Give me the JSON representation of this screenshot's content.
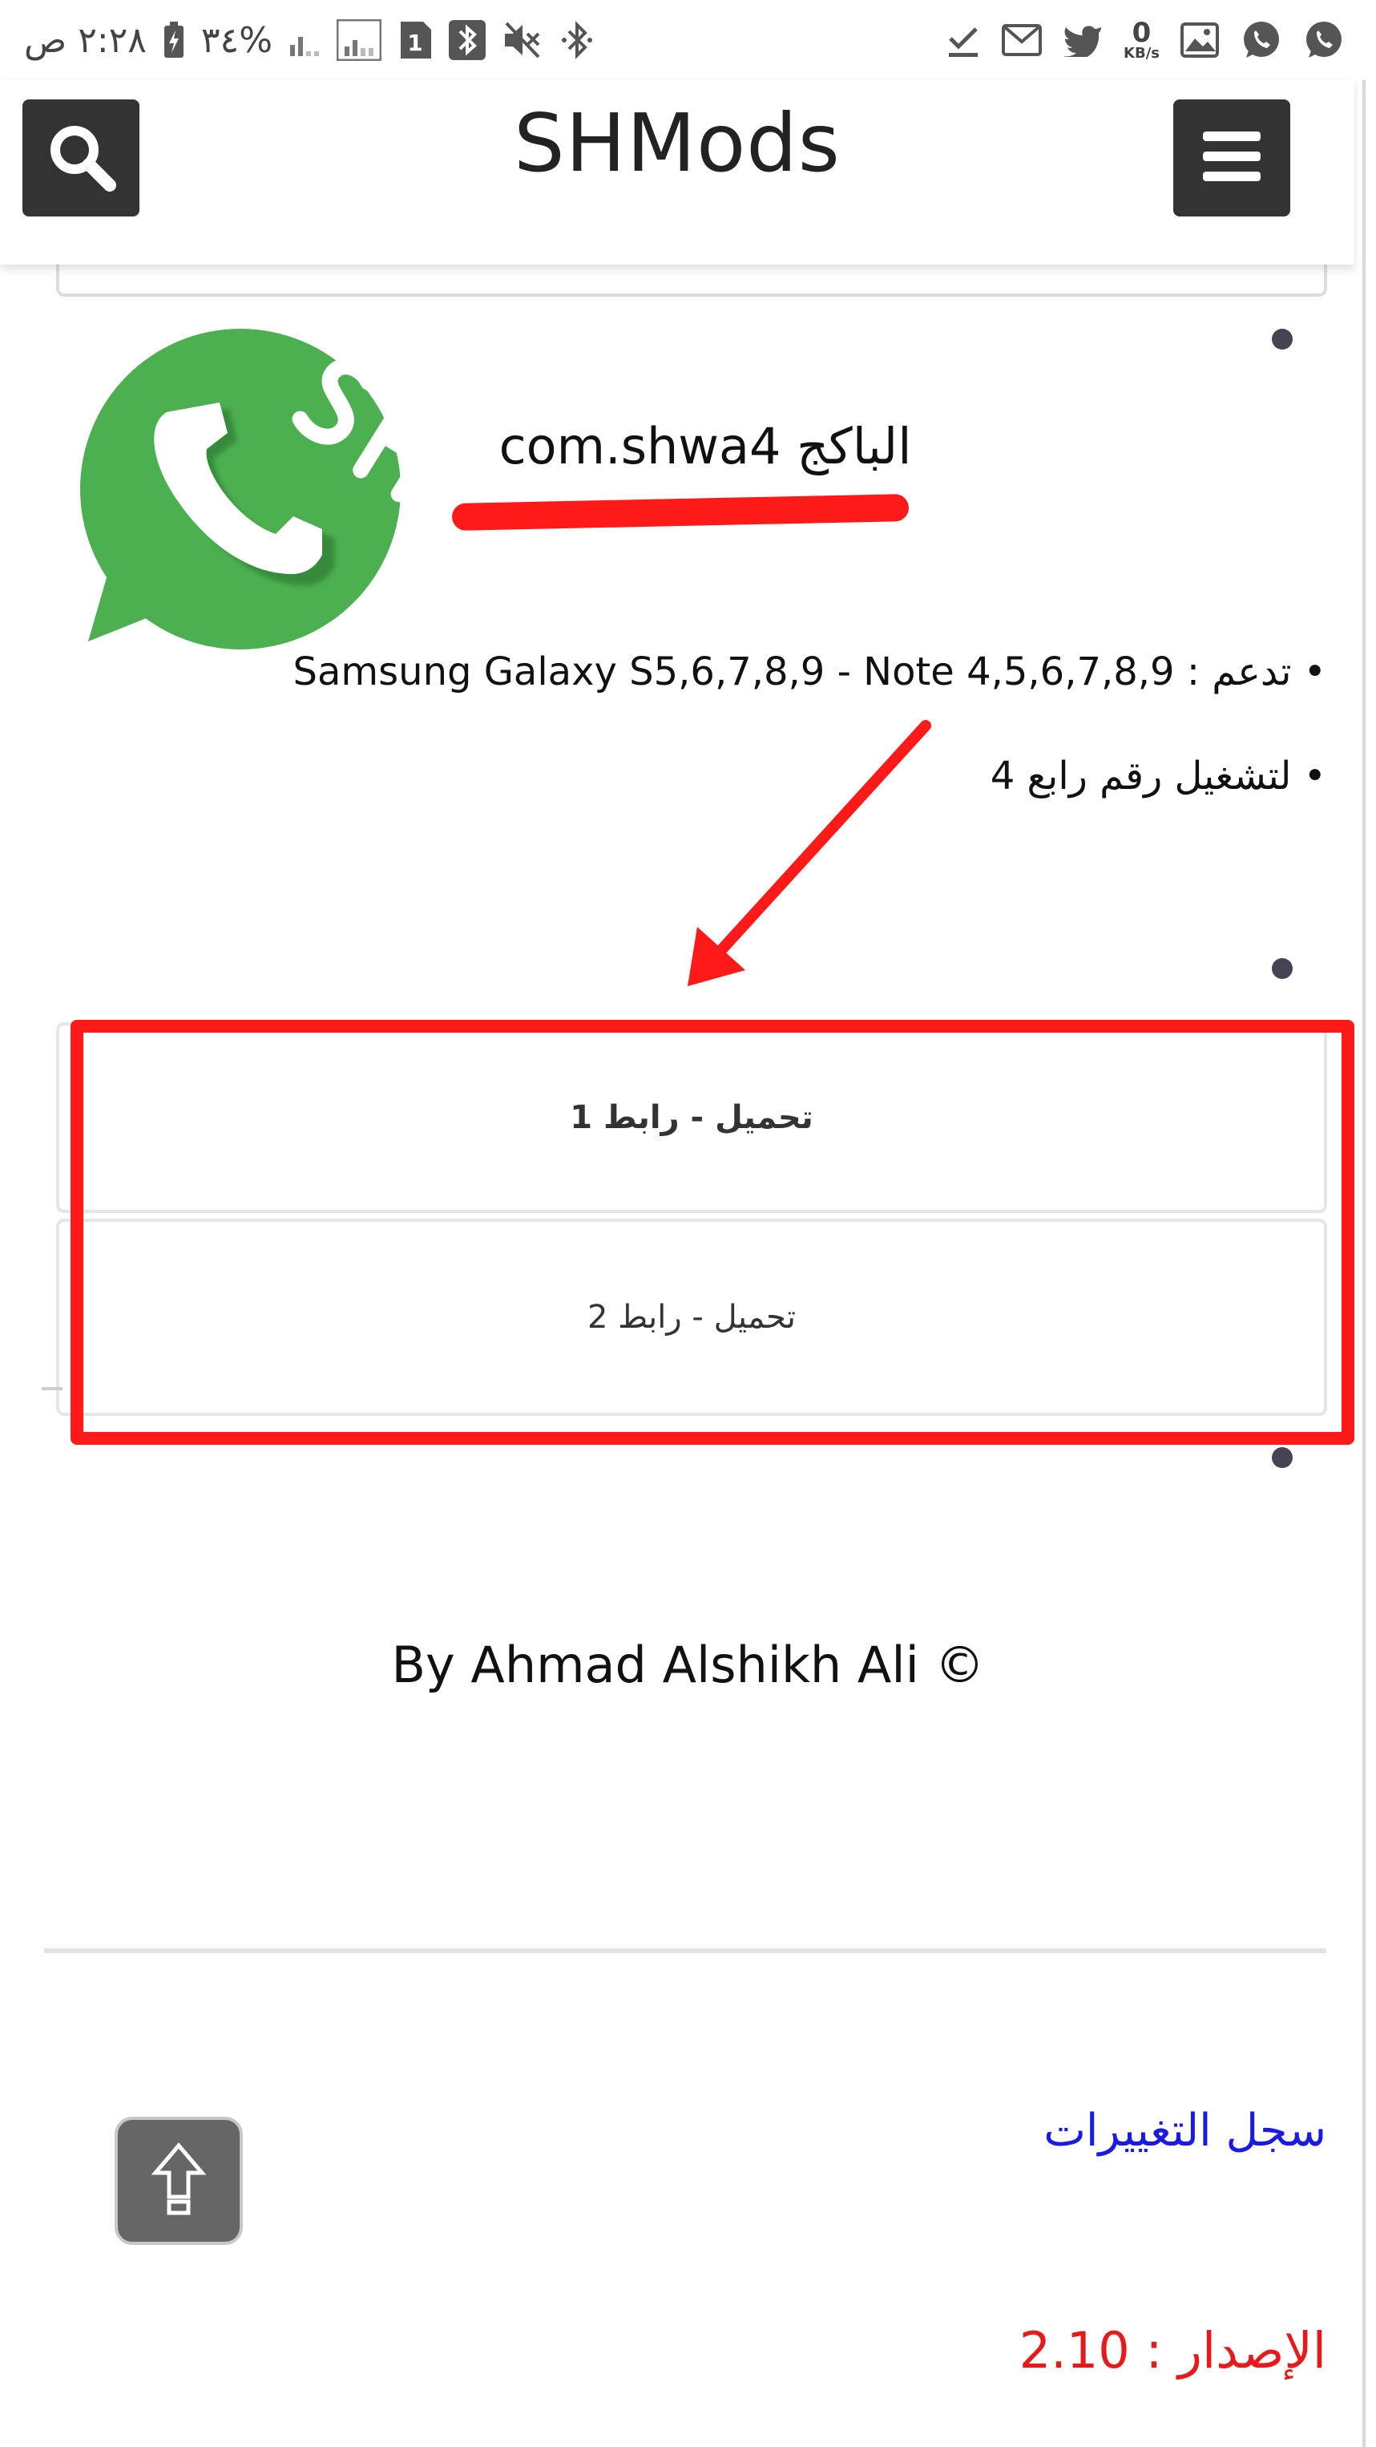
{
  "status_bar": {
    "time_text": "٢:٢٨ ص",
    "battery_text": "٣٤%",
    "sim_badge": "1",
    "network_speed_value": "0",
    "network_speed_unit": "KB/s"
  },
  "header": {
    "title": "SHMods",
    "search_icon": "search-icon",
    "menu_icon": "hamburger-menu-icon"
  },
  "app": {
    "logo_text": "SH",
    "package_text": "الباكج com.shwa4",
    "support_line": "• تدعم : Samsung Galaxy S5,6,7,8,9 - Note 4,5,6,7,8,9",
    "run_line": "• لتشغيل رقم رابع 4"
  },
  "downloads": {
    "link1": "تحميل - رابط 1",
    "link2": "تحميل - رابط 2"
  },
  "footer": {
    "credit": "By Ahmad Alshikh Ali ©",
    "changelog": "سجل التغييرات",
    "version": "الإصدار : 2.10",
    "back_to_top_icon": "arrow-up-icon"
  },
  "colors": {
    "annotation_red": "#ff1a1a",
    "header_button_bg": "#333333",
    "logo_green": "#4caf50",
    "link_blue": "#1a1ae6",
    "version_red": "#e61a1a"
  }
}
